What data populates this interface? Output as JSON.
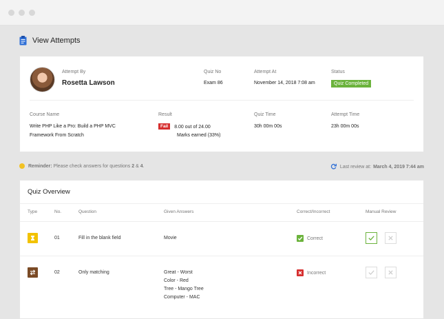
{
  "page": {
    "title": "View Attempts"
  },
  "attempt": {
    "attempt_by_label": "Attempt By",
    "attempt_by": "Rosetta Lawson",
    "quiz_no_label": "Quiz No",
    "quiz_no": "Exam 86",
    "attempt_at_label": "Attempt At",
    "attempt_at": "November 14, 2018 7:08 am",
    "status_label": "Status",
    "status": "Quiz Completed",
    "course_name_label": "Course Name",
    "course_name_line1": "Write PHP Like a Pro: Build a PHP MVC",
    "course_name_line2": "Framework From Scratch",
    "result_label": "Result",
    "result_badge": "Fail",
    "result_score": "8.00 out of 24.00",
    "result_marks": "Marks earned (33%)",
    "quiz_time_label": "Quiz Time",
    "quiz_time": "30h 00m 00s",
    "attempt_time_label": "Attempt Time",
    "attempt_time": "23h 00m 00s"
  },
  "reminder": {
    "prefix": "Reminder:",
    "text": "Please check answers for questions",
    "q1": "2",
    "amp": "&",
    "q2": "4",
    "suffix": "."
  },
  "last_review": {
    "label": "Last review at:",
    "value": "March 4, 2019 7:44 am"
  },
  "overview": {
    "title": "Quiz Overview",
    "columns": {
      "type": "Type",
      "no": "No.",
      "question": "Question",
      "given_answers": "Given Answers",
      "correct_incorrect": "Correct/Incorrect",
      "manual_review": "Manual Review"
    },
    "rows": [
      {
        "no": "01",
        "question": "Fill in the blank field",
        "answers": [
          "Movie"
        ],
        "result": "Correct",
        "type_icon": "hourglass-icon",
        "type_color": "#f2c200",
        "result_color": "#6bb33c"
      },
      {
        "no": "02",
        "question": "Only matching",
        "answers": [
          "Great - Worst",
          "Color - Red",
          "Tree - Mango Tree",
          "Computer - MAC"
        ],
        "result": "Incorrect",
        "type_icon": "swap-icon",
        "type_color": "#7a4a25",
        "result_color": "#d62f2f"
      }
    ]
  }
}
